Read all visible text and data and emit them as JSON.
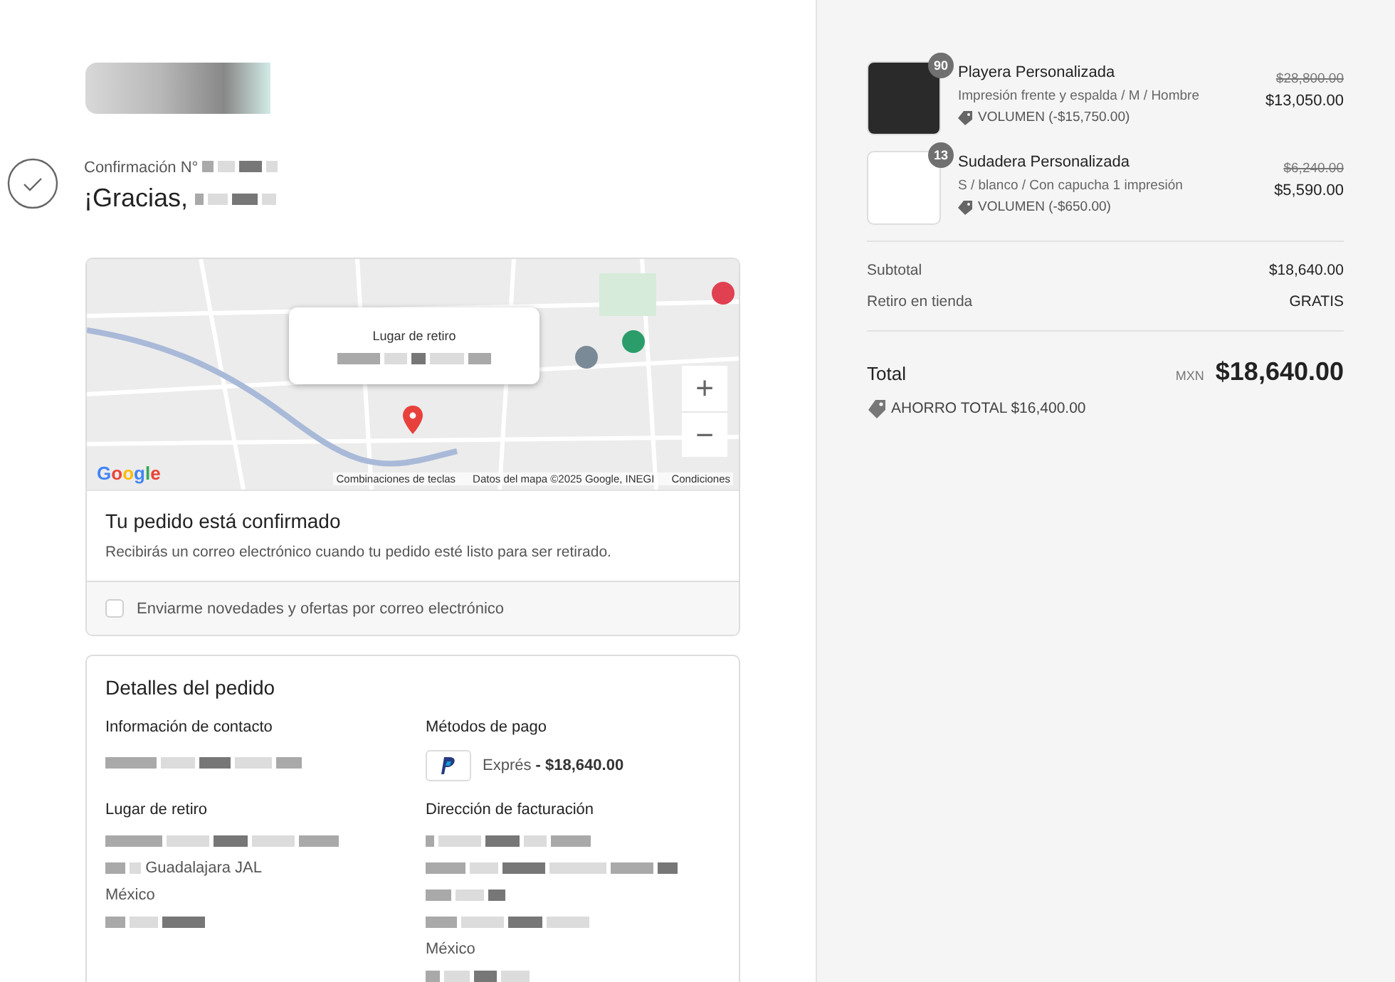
{
  "header": {
    "confirmation_label": "Confirmación N°",
    "greeting": "¡Gracias,"
  },
  "map": {
    "popup": {
      "title": "Lugar de retiro"
    },
    "zoom_in": "+",
    "zoom_out": "−",
    "logo": "Google",
    "attribution": [
      "Combinaciones de teclas",
      "Datos del mapa ©2025 Google, INEGI",
      "Condiciones"
    ]
  },
  "status": {
    "title": "Tu pedido está confirmado",
    "message": "Recibirás un correo electrónico cuando tu pedido esté listo para ser retirado."
  },
  "newsletter": {
    "label": "Enviarme novedades y ofertas por correo electrónico",
    "checked": false
  },
  "details": {
    "title": "Detalles del pedido",
    "sections": [
      {
        "kind": "contact",
        "title": "Información de contacto"
      },
      {
        "kind": "payment",
        "title": "Métodos de pago",
        "method": "Exprés",
        "amount": "- $18,640.00"
      },
      {
        "kind": "address",
        "title": "Lugar de retiro",
        "lines": [
          "Guadalajara JAL",
          "México"
        ]
      },
      {
        "kind": "address",
        "title": "Dirección de facturación",
        "lines": [
          "México"
        ]
      }
    ]
  },
  "cart": {
    "items": [
      {
        "name": "Playera Personalizada",
        "variant": "Impresión frente y espalda / M / Hombre",
        "discount": "VOLUMEN (-$15,750.00)",
        "original_price": "$28,800.00",
        "price": "$13,050.00",
        "quantity": "90",
        "kind": "tshirt"
      },
      {
        "name": "Sudadera Personalizada",
        "variant": "S / blanco / Con capucha 1 impresión",
        "discount": "VOLUMEN (-$650.00)",
        "original_price": "$6,240.00",
        "price": "$5,590.00",
        "quantity": "13",
        "kind": "hoodie"
      }
    ],
    "summary": [
      {
        "label": "Subtotal",
        "value": "$18,640.00"
      },
      {
        "label": "Retiro en tienda",
        "value": "GRATIS"
      }
    ],
    "total": {
      "label": "Total",
      "currency": "MXN",
      "value": "$18,640.00"
    },
    "savings": "AHORRO TOTAL $16,400.00"
  }
}
